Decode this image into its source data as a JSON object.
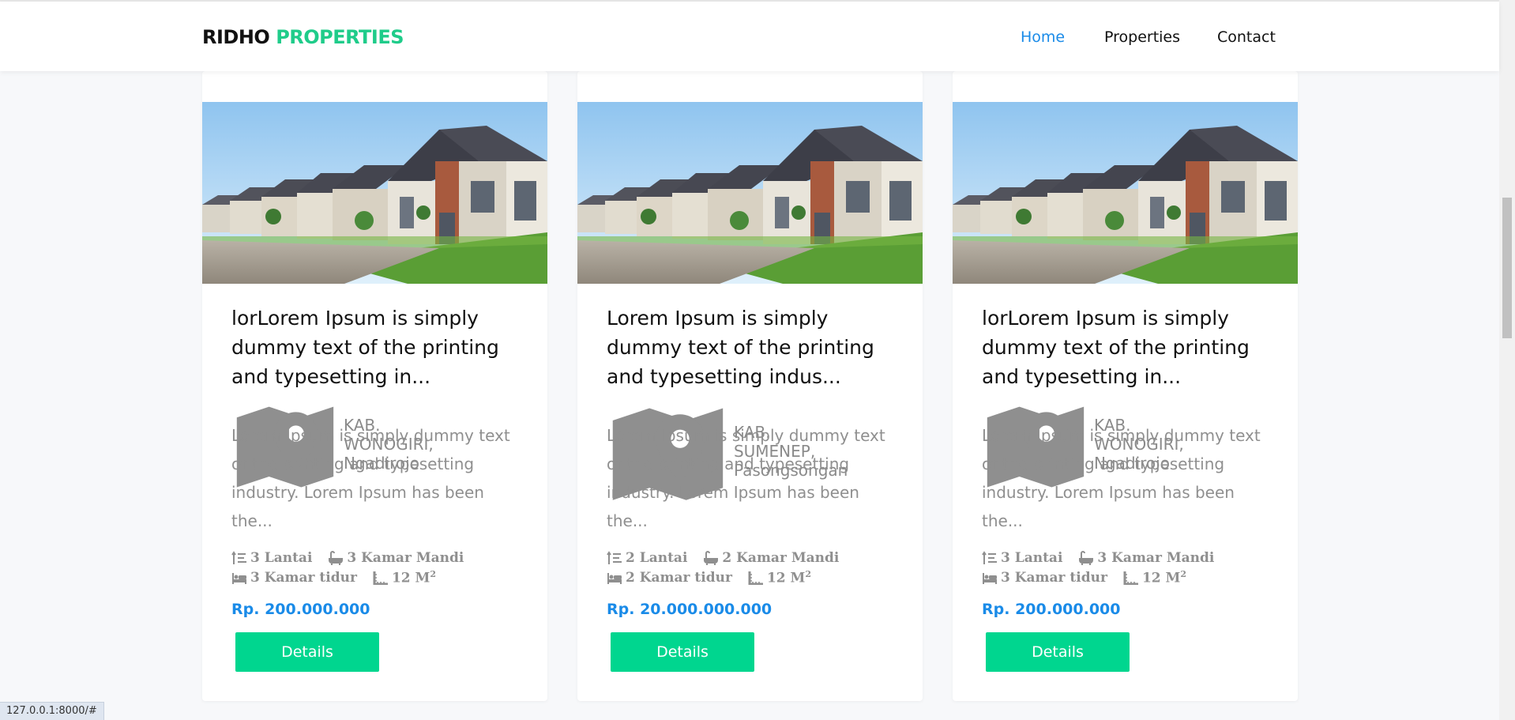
{
  "brand": {
    "part1": "RIDHO",
    "part2": "PROPERTIES",
    "accent_color": "#1fcc8a"
  },
  "nav": {
    "home": "Home",
    "properties": "Properties",
    "contact": "Contact",
    "active_color": "#1a8be8"
  },
  "cards": [
    {
      "title": "lorLorem Ipsum is simply dummy text of the printing and typesetting in...",
      "location": "KAB. WONOGIRI, Ngadirojo",
      "description": "Lorem Ipsum is simply dummy text of the printing and typesetting industry. Lorem Ipsum has been the...",
      "floors": "3 Lantai",
      "bathrooms": "3 Kamar Mandi",
      "bedrooms": "3 Kamar tidur",
      "area": "12 M",
      "area_sup": "2",
      "price": "Rp. 200.000.000",
      "button": "Details"
    },
    {
      "title": "Lorem Ipsum is simply dummy text of the printing and typesetting indus...",
      "location": "KAB. SUMENEP, Pasongsongan",
      "description": "Lorem Ipsum is simply dummy text of the printing and typesetting industry. Lorem Ipsum has been the...",
      "floors": "2 Lantai",
      "bathrooms": "2 Kamar Mandi",
      "bedrooms": "2 Kamar tidur",
      "area": "12 M",
      "area_sup": "2",
      "price": "Rp. 20.000.000.000",
      "button": "Details"
    },
    {
      "title": "lorLorem Ipsum is simply dummy text of the printing and typesetting in...",
      "location": "KAB. WONOGIRI, Ngadirojo",
      "description": "Lorem Ipsum is simply dummy text of the printing and typesetting industry. Lorem Ipsum has been the...",
      "floors": "3 Lantai",
      "bathrooms": "3 Kamar Mandi",
      "bedrooms": "3 Kamar tidur",
      "area": "12 M",
      "area_sup": "2",
      "price": "Rp. 200.000.000",
      "button": "Details"
    }
  ],
  "icons": {
    "location": "map-marker-icon",
    "floors": "stairs-icon",
    "bathrooms": "bathtub-icon",
    "bedrooms": "bed-icon",
    "area": "ruler-icon"
  },
  "status_bar": {
    "url": "127.0.0.1:8000/#"
  },
  "colors": {
    "price": "#1a8be8",
    "button": "#00d68f",
    "muted_text": "#8f8f8f"
  }
}
